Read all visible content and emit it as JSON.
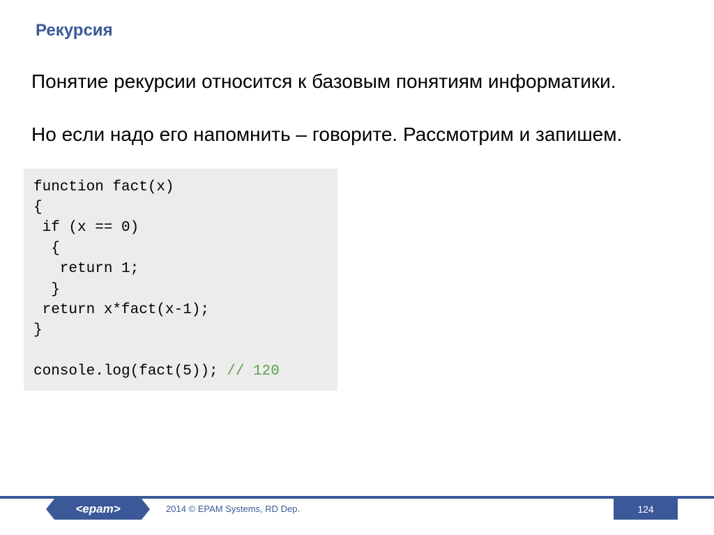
{
  "title": "Рекурсия",
  "body": {
    "p1": "Понятие рекурсии относится к базовым понятиям информатики.",
    "p2": "Но если надо его напомнить – говорите. Рассмотрим и запишем."
  },
  "code": {
    "l1": "function fact(x)",
    "l2": "{",
    "l3": " if (x == 0)",
    "l4": "  {",
    "l5": "   return 1;",
    "l6": "  }",
    "l7": " return x*fact(x-1);",
    "l8": "}",
    "l9": "",
    "l10a": "console.log(fact(5)); ",
    "l10b": "// 120"
  },
  "footer": {
    "logo": "<epam>",
    "copyright": "2014 © EPAM Systems, RD Dep.",
    "page": "124"
  }
}
